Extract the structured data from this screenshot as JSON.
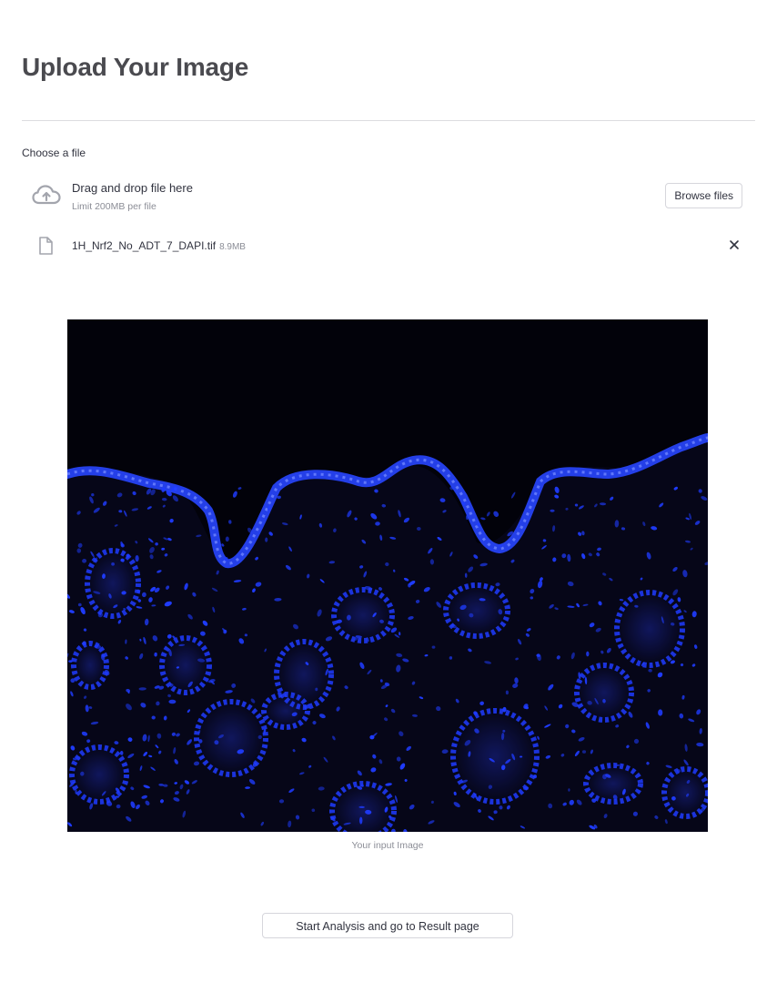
{
  "page": {
    "title": "Upload Your Image"
  },
  "uploader": {
    "label": "Choose a file",
    "drop_title": "Drag and drop file here",
    "limit_text": "Limit 200MB per file",
    "browse_label": "Browse files",
    "icon": "cloud-upload-icon"
  },
  "uploaded_file": {
    "name": "1H_Nrf2_No_ADT_7_DAPI.tif",
    "size": "8.9MB",
    "icon": "file-icon",
    "remove_icon": "close-icon"
  },
  "preview": {
    "caption": "Your input Image",
    "stain_color": "#1f3cff",
    "background_color": "#02020a"
  },
  "actions": {
    "start_label": "Start Analysis and go to Result page"
  }
}
